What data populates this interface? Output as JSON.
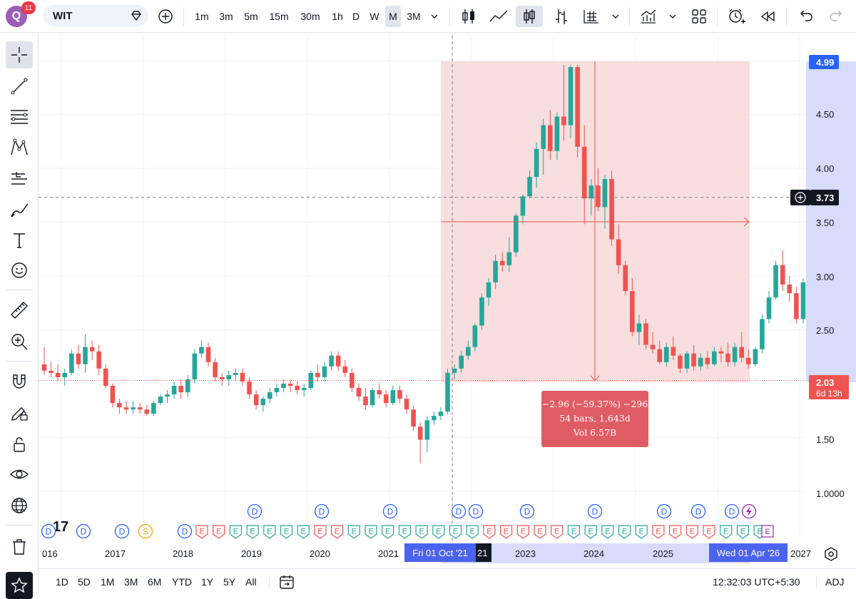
{
  "symbol": {
    "name": "WIT",
    "badge": "11",
    "avatar_letter": "Q"
  },
  "intervals": [
    "1m",
    "3m",
    "5m",
    "15m",
    "30m",
    "1h",
    "D",
    "W",
    "M",
    "3M"
  ],
  "active_interval": "M",
  "price_axis": {
    "ticks": [
      "4.99",
      "4.50",
      "4.00",
      "3.50",
      "3.00",
      "2.50",
      "2.03",
      "1.50",
      "1.0000"
    ],
    "last_price": "2.03",
    "countdown": "6d 13h",
    "crosshair_price": "3.73"
  },
  "time_axis": {
    "labels": [
      "016",
      "2017",
      "2018",
      "2019",
      "2020",
      "2021",
      "2023",
      "2024",
      "2025",
      "2027"
    ],
    "cursor_label": "Fri 01 Oct '21",
    "cursor_suffix": "21",
    "end_label": "Wed 01 Apr '26"
  },
  "measure": {
    "line1": "−2.96 (−59.37%) −296",
    "line2": "54 bars, 1,643d",
    "line3": "Vol 6.57B"
  },
  "events": {
    "dividend_letter": "D",
    "earnings_letter": "E",
    "split_letter": "S",
    "logo_text": "17"
  },
  "ranges": [
    "1D",
    "5D",
    "1M",
    "3M",
    "6M",
    "YTD",
    "1Y",
    "5Y",
    "All"
  ],
  "clock": "12:32:03 UTC+5:30",
  "adj_label": "ADJ",
  "colors": {
    "up": "#26a69a",
    "down": "#ef5350",
    "accent": "#2962ff",
    "measure_fill": "#f7dada",
    "measure_label": "#e05c65"
  },
  "chart_data": {
    "type": "candlestick",
    "start_date": "2015-10",
    "interval": "1M",
    "ohlc": [
      [
        2.18,
        2.34,
        2.08,
        2.12
      ],
      [
        2.12,
        2.2,
        2.06,
        2.1
      ],
      [
        2.1,
        2.18,
        2.02,
        2.06
      ],
      [
        2.06,
        2.14,
        1.98,
        2.1
      ],
      [
        2.1,
        2.32,
        2.08,
        2.28
      ],
      [
        2.28,
        2.36,
        2.14,
        2.18
      ],
      [
        2.18,
        2.46,
        2.1,
        2.34
      ],
      [
        2.34,
        2.4,
        2.22,
        2.3
      ],
      [
        2.3,
        2.36,
        2.08,
        2.14
      ],
      [
        2.14,
        2.18,
        1.96,
        1.98
      ],
      [
        1.98,
        2.0,
        1.78,
        1.82
      ],
      [
        1.82,
        1.86,
        1.72,
        1.78
      ],
      [
        1.78,
        1.84,
        1.72,
        1.76
      ],
      [
        1.76,
        1.84,
        1.72,
        1.78
      ],
      [
        1.78,
        1.82,
        1.72,
        1.76
      ],
      [
        1.76,
        1.8,
        1.7,
        1.72
      ],
      [
        1.72,
        1.84,
        1.7,
        1.82
      ],
      [
        1.82,
        1.9,
        1.8,
        1.88
      ],
      [
        1.88,
        1.94,
        1.82,
        1.9
      ],
      [
        1.9,
        2.02,
        1.86,
        1.98
      ],
      [
        1.98,
        2.04,
        1.86,
        1.92
      ],
      [
        1.92,
        2.08,
        1.88,
        2.04
      ],
      [
        2.04,
        2.32,
        2.0,
        2.28
      ],
      [
        2.28,
        2.4,
        2.24,
        2.34
      ],
      [
        2.34,
        2.38,
        2.16,
        2.2
      ],
      [
        2.2,
        2.24,
        2.02,
        2.06
      ],
      [
        2.06,
        2.1,
        1.98,
        2.04
      ],
      [
        2.04,
        2.12,
        1.98,
        2.08
      ],
      [
        2.08,
        2.14,
        2.02,
        2.1
      ],
      [
        2.1,
        2.14,
        1.98,
        2.02
      ],
      [
        2.02,
        2.06,
        1.86,
        1.9
      ],
      [
        1.9,
        1.94,
        1.76,
        1.8
      ],
      [
        1.8,
        1.88,
        1.74,
        1.86
      ],
      [
        1.86,
        1.96,
        1.82,
        1.92
      ],
      [
        1.92,
        2.0,
        1.88,
        1.96
      ],
      [
        1.96,
        2.04,
        1.92,
        2.0
      ],
      [
        2.0,
        2.04,
        1.92,
        1.98
      ],
      [
        1.98,
        2.02,
        1.9,
        1.94
      ],
      [
        1.94,
        2.0,
        1.88,
        1.96
      ],
      [
        1.96,
        2.12,
        1.94,
        2.1
      ],
      [
        2.1,
        2.18,
        2.02,
        2.06
      ],
      [
        2.06,
        2.2,
        2.02,
        2.16
      ],
      [
        2.16,
        2.3,
        2.12,
        2.26
      ],
      [
        2.26,
        2.3,
        2.12,
        2.16
      ],
      [
        2.16,
        2.22,
        2.06,
        2.1
      ],
      [
        2.1,
        2.14,
        1.92,
        1.96
      ],
      [
        1.96,
        2.0,
        1.84,
        1.88
      ],
      [
        1.88,
        1.96,
        1.76,
        1.8
      ],
      [
        1.8,
        1.96,
        1.78,
        1.94
      ],
      [
        1.94,
        2.0,
        1.86,
        1.9
      ],
      [
        1.9,
        1.94,
        1.78,
        1.82
      ],
      [
        1.82,
        1.98,
        1.8,
        1.94
      ],
      [
        1.94,
        1.98,
        1.82,
        1.86
      ],
      [
        1.86,
        1.9,
        1.72,
        1.76
      ],
      [
        1.76,
        1.8,
        1.56,
        1.6
      ],
      [
        1.6,
        1.64,
        1.26,
        1.48
      ],
      [
        1.48,
        1.7,
        1.36,
        1.66
      ],
      [
        1.66,
        1.74,
        1.62,
        1.7
      ],
      [
        1.7,
        1.78,
        1.66,
        1.74
      ],
      [
        1.74,
        2.14,
        1.72,
        2.1
      ],
      [
        2.1,
        2.18,
        2.04,
        2.14
      ],
      [
        2.14,
        2.3,
        2.1,
        2.26
      ],
      [
        2.26,
        2.4,
        2.22,
        2.34
      ],
      [
        2.34,
        2.56,
        2.3,
        2.54
      ],
      [
        2.54,
        2.84,
        2.5,
        2.8
      ],
      [
        2.8,
        2.98,
        2.72,
        2.94
      ],
      [
        2.94,
        3.2,
        2.88,
        3.14
      ],
      [
        3.14,
        3.22,
        3.04,
        3.1
      ],
      [
        3.1,
        3.36,
        3.04,
        3.22
      ],
      [
        3.22,
        3.58,
        3.18,
        3.56
      ],
      [
        3.56,
        3.76,
        3.48,
        3.74
      ],
      [
        3.74,
        3.98,
        3.72,
        3.92
      ],
      [
        3.92,
        4.24,
        3.82,
        4.18
      ],
      [
        4.18,
        4.46,
        3.94,
        4.4
      ],
      [
        4.4,
        4.54,
        4.08,
        4.16
      ],
      [
        4.16,
        4.52,
        4.08,
        4.48
      ],
      [
        4.48,
        4.96,
        4.26,
        4.4
      ],
      [
        4.4,
        4.96,
        4.28,
        4.94
      ],
      [
        4.94,
        4.96,
        4.1,
        4.2
      ],
      [
        4.2,
        4.4,
        3.48,
        3.72
      ],
      [
        3.72,
        3.9,
        3.56,
        3.84
      ],
      [
        3.84,
        4.0,
        3.6,
        3.64
      ],
      [
        3.64,
        3.94,
        3.44,
        3.9
      ],
      [
        3.9,
        3.98,
        3.28,
        3.34
      ],
      [
        3.34,
        3.48,
        3.02,
        3.1
      ],
      [
        3.1,
        3.14,
        2.82,
        2.86
      ],
      [
        2.86,
        2.98,
        2.44,
        2.48
      ],
      [
        2.48,
        2.64,
        2.36,
        2.56
      ],
      [
        2.56,
        2.6,
        2.32,
        2.36
      ],
      [
        2.36,
        2.48,
        2.28,
        2.32
      ],
      [
        2.32,
        2.4,
        2.18,
        2.2
      ],
      [
        2.2,
        2.38,
        2.16,
        2.34
      ],
      [
        2.34,
        2.44,
        2.22,
        2.26
      ],
      [
        2.26,
        2.28,
        2.1,
        2.14
      ],
      [
        2.14,
        2.3,
        2.1,
        2.28
      ],
      [
        2.28,
        2.36,
        2.12,
        2.16
      ],
      [
        2.16,
        2.28,
        2.12,
        2.24
      ],
      [
        2.24,
        2.3,
        2.14,
        2.18
      ],
      [
        2.18,
        2.34,
        2.16,
        2.3
      ],
      [
        2.3,
        2.34,
        2.2,
        2.28
      ],
      [
        2.28,
        2.38,
        2.16,
        2.2
      ],
      [
        2.2,
        2.38,
        2.16,
        2.34
      ],
      [
        2.34,
        2.48,
        2.2,
        2.24
      ],
      [
        2.24,
        2.32,
        2.14,
        2.18
      ],
      [
        2.18,
        2.34,
        2.16,
        2.32
      ],
      [
        2.32,
        2.64,
        2.28,
        2.6
      ],
      [
        2.6,
        2.86,
        2.56,
        2.8
      ],
      [
        2.8,
        3.14,
        2.78,
        3.1
      ],
      [
        3.1,
        3.24,
        2.86,
        2.92
      ],
      [
        2.92,
        3.0,
        2.76,
        2.84
      ],
      [
        2.84,
        2.9,
        2.56,
        2.6
      ],
      [
        2.6,
        2.98,
        2.56,
        2.94
      ],
      [
        2.94,
        3.2,
        2.88,
        3.16
      ],
      [
        3.16,
        3.48,
        3.1,
        3.24
      ],
      [
        3.24,
        3.34,
        3.18,
        3.26
      ],
      [
        3.26,
        3.46,
        3.2,
        3.44
      ],
      [
        3.44,
        3.54,
        3.36,
        3.52
      ],
      [
        3.52,
        3.74,
        3.48,
        3.7
      ],
      [
        3.7,
        3.78,
        3.6,
        3.66
      ],
      [
        3.66,
        3.72,
        3.24,
        3.28
      ],
      [
        3.28,
        3.34,
        2.96,
        3.02
      ],
      [
        3.02,
        3.12,
        2.82,
        2.88
      ],
      [
        2.88,
        3.04,
        2.66,
        2.94
      ],
      [
        2.94,
        3.06,
        2.86,
        2.9
      ],
      [
        2.9,
        3.02,
        2.78,
        2.84
      ],
      [
        2.84,
        2.92,
        2.66,
        2.7
      ],
      [
        2.7,
        2.8,
        2.6,
        2.66
      ],
      [
        2.66,
        2.72,
        2.56,
        2.62
      ],
      [
        2.62,
        2.7,
        2.56,
        2.68
      ],
      [
        2.68,
        3.08,
        2.64,
        2.74
      ],
      [
        2.74,
        2.98,
        2.46,
        2.52
      ],
      [
        2.52,
        2.66,
        2.16,
        2.2
      ],
      [
        2.2,
        2.34,
        2.06,
        2.12
      ],
      [
        2.12,
        2.3,
        2.0,
        2.03
      ]
    ]
  }
}
